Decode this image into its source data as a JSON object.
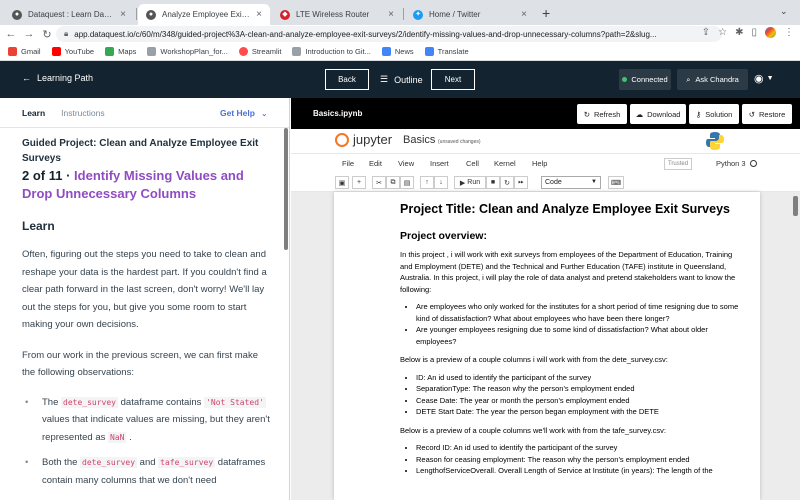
{
  "browser": {
    "tabs": [
      {
        "title": "Dataquest : Learn Data Scienc",
        "color": "#555555"
      },
      {
        "title": "Analyze Employee Exit Surveys",
        "color": "#555555"
      },
      {
        "title": "LTE Wireless Router",
        "color": "#d6202c"
      },
      {
        "title": "Home / Twitter",
        "color": "#1d9bf0"
      }
    ],
    "url": "app.dataquest.io/c/60/m/348/guided-project%3A-clean-and-analyze-employee-exit-surveys/2/identify-missing-values-and-drop-unnecessary-columns?path=2&slug...",
    "bookmarks": [
      "Gmail",
      "YouTube",
      "Maps",
      "WorkshopPlan_for...",
      "Streamlit",
      "Introduction to Git...",
      "News",
      "Translate"
    ]
  },
  "header": {
    "learning_path": "Learning Path",
    "back": "Back",
    "outline": "Outline",
    "next": "Next",
    "connected": "Connected",
    "ask_chandra": "Ask Chandra"
  },
  "left": {
    "tab_learn": "Learn",
    "tab_instructions": "Instructions",
    "get_help": "Get Help",
    "project_title": "Guided Project: Clean and Analyze Employee Exit Surveys",
    "step_number": "2 of 11 ·",
    "step_name": "Identify Missing Values and Drop Unnecessary Columns",
    "learn_heading": "Learn",
    "para1": "Often, figuring out the steps you need to take to clean and reshape your data is the hardest part. If you couldn't find a clear path forward in the last screen, don't worry! We'll lay out the steps for you, but give you some room to start making your own decisions.",
    "para2": "From our work in the previous screen, we can first make the following observations:",
    "b1_pre": "The ",
    "b1_code1": "dete_survey",
    "b1_mid": " dataframe contains ",
    "b1_code2": "'Not Stated'",
    "b1_mid2": " values that indicate values are missing, but they aren't represented as ",
    "b1_code3": "NaN",
    "b1_post": " .",
    "b2_pre": "Both the ",
    "b2_code1": "dete_survey",
    "b2_mid": " and ",
    "b2_code2": "tafe_survey",
    "b2_post": " dataframes contain many columns that we don't need"
  },
  "notebook": {
    "file": "Basics.ipynb",
    "refresh": "Refresh",
    "download": "Download",
    "solution": "Solution",
    "restore": "Restore",
    "jupyter": "jupyter",
    "name": "Basics",
    "unsaved": "(unsaved changes)",
    "menu": [
      "File",
      "Edit",
      "View",
      "Insert",
      "Cell",
      "Kernel",
      "Help"
    ],
    "trusted": "Trusted",
    "kernel": "Python 3",
    "run": "Run",
    "cell_type": "Code"
  },
  "markdown": {
    "title": "Project Title: Clean and Analyze Employee Exit Surveys",
    "overview": "Project overview:",
    "intro": "In this project , i will work with exit surveys from employees of the Department of Education, Training and Employment (DETE) and the Technical and Further Education (TAFE) institute in Queensland, Australia. In this project, i will play the role of data analyst and pretend stakeholders want to know the following:",
    "questions": [
      "Are employees who only worked for the institutes for a short period of time resigning due to some kind of dissatisfaction? What about employees who have been there longer?",
      "Are younger employees resigning due to some kind of dissatisfaction? What about older employees?"
    ],
    "dete_intro": "Below is a preview of a couple columns i will work with from the dete_survey.csv:",
    "dete_cols": [
      "ID: An id used to identify the participant of the survey",
      "SeparationType: The reason why the person's employment ended",
      "Cease Date: The year or month the person's employment ended",
      "DETE Start Date: The year the person began employment with the DETE"
    ],
    "tafe_intro": "Below is a preview of a couple columns we'll work with from the tafe_survey.csv:",
    "tafe_cols": [
      "Record ID: An id used to identify the participant of the survey",
      "Reason for ceasing employment: The reason why the person's employment ended",
      "LengthofServiceOverall. Overall Length of Service at Institute (in years): The length of the"
    ]
  }
}
